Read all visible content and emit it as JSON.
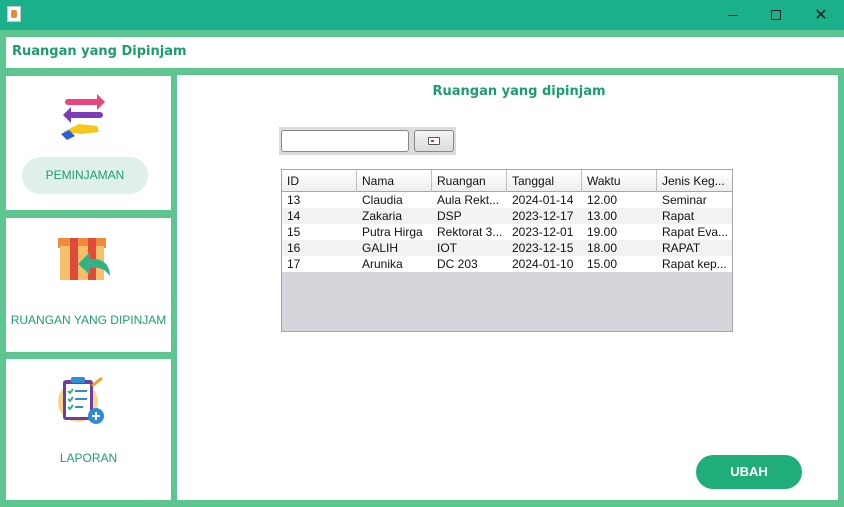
{
  "window": {
    "minimize_glyph": "",
    "maximize_glyph": "",
    "close_glyph": "✕"
  },
  "header": {
    "title": "Ruangan yang Dipinjam"
  },
  "sidebar": {
    "items": [
      {
        "label": "PEMINJAMAN",
        "icon": "swap-arrows-hand-icon"
      },
      {
        "label": "RUANGAN YANG DIPINJAM",
        "icon": "box-return-arrow-icon"
      },
      {
        "label": "LAPORAN",
        "icon": "clipboard-checklist-icon"
      }
    ]
  },
  "main": {
    "title": "Ruangan yang dipinjam",
    "search": {
      "value": "",
      "placeholder": ""
    },
    "table": {
      "columns": [
        "ID",
        "Nama",
        "Ruangan",
        "Tanggal",
        "Waktu",
        "Jenis Keg..."
      ],
      "rows": [
        [
          "13",
          "Claudia",
          "Aula Rekt...",
          "2024-01-14",
          "12.00",
          "Seminar"
        ],
        [
          "14",
          "Zakaria",
          "DSP",
          "2023-12-17",
          "13.00",
          "Rapat"
        ],
        [
          "15",
          "Putra Hirga",
          "Rektorat 3...",
          "2023-12-01",
          "19.00",
          "Rapat Eva..."
        ],
        [
          "16",
          "GALIH",
          "IOT",
          "2023-12-15",
          "18.00",
          "RAPAT"
        ],
        [
          "17",
          "Arunika",
          "DC 203",
          "2024-01-10",
          "15.00",
          "Rapat kep..."
        ]
      ]
    },
    "ubah_label": "UBAH"
  },
  "colors": {
    "titlebar": "#1ab08a",
    "frame": "#5dc58f",
    "accent_text": "#1b9e6e",
    "button": "#1fae7a"
  }
}
